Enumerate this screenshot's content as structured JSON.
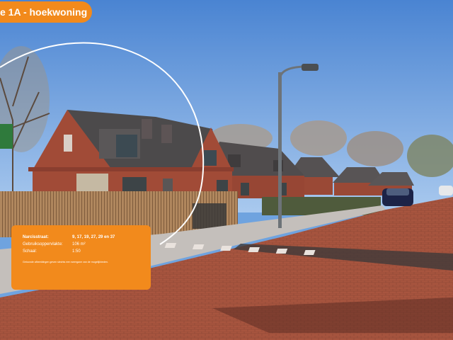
{
  "header": {
    "title": "e 1A - hoekwoning"
  },
  "info_card": {
    "rows": [
      {
        "label": "Narcisstraat:",
        "value": "9, 17, 19, 27, 29 en 37"
      },
      {
        "label": "Gebruiksoppervlakte:",
        "value": "106 m²"
      },
      {
        "label": "Schaal:",
        "value": "1:50"
      }
    ],
    "note": "Getoonde afbeeldingen geven slechts een weergave van de mogelijkheden."
  },
  "colors": {
    "accent": "#f28a1c",
    "sky": "#6fa3df",
    "brick": "#9e4a37",
    "roof": "#4c4a4b"
  },
  "icons": [
    "street-sign-icon"
  ]
}
